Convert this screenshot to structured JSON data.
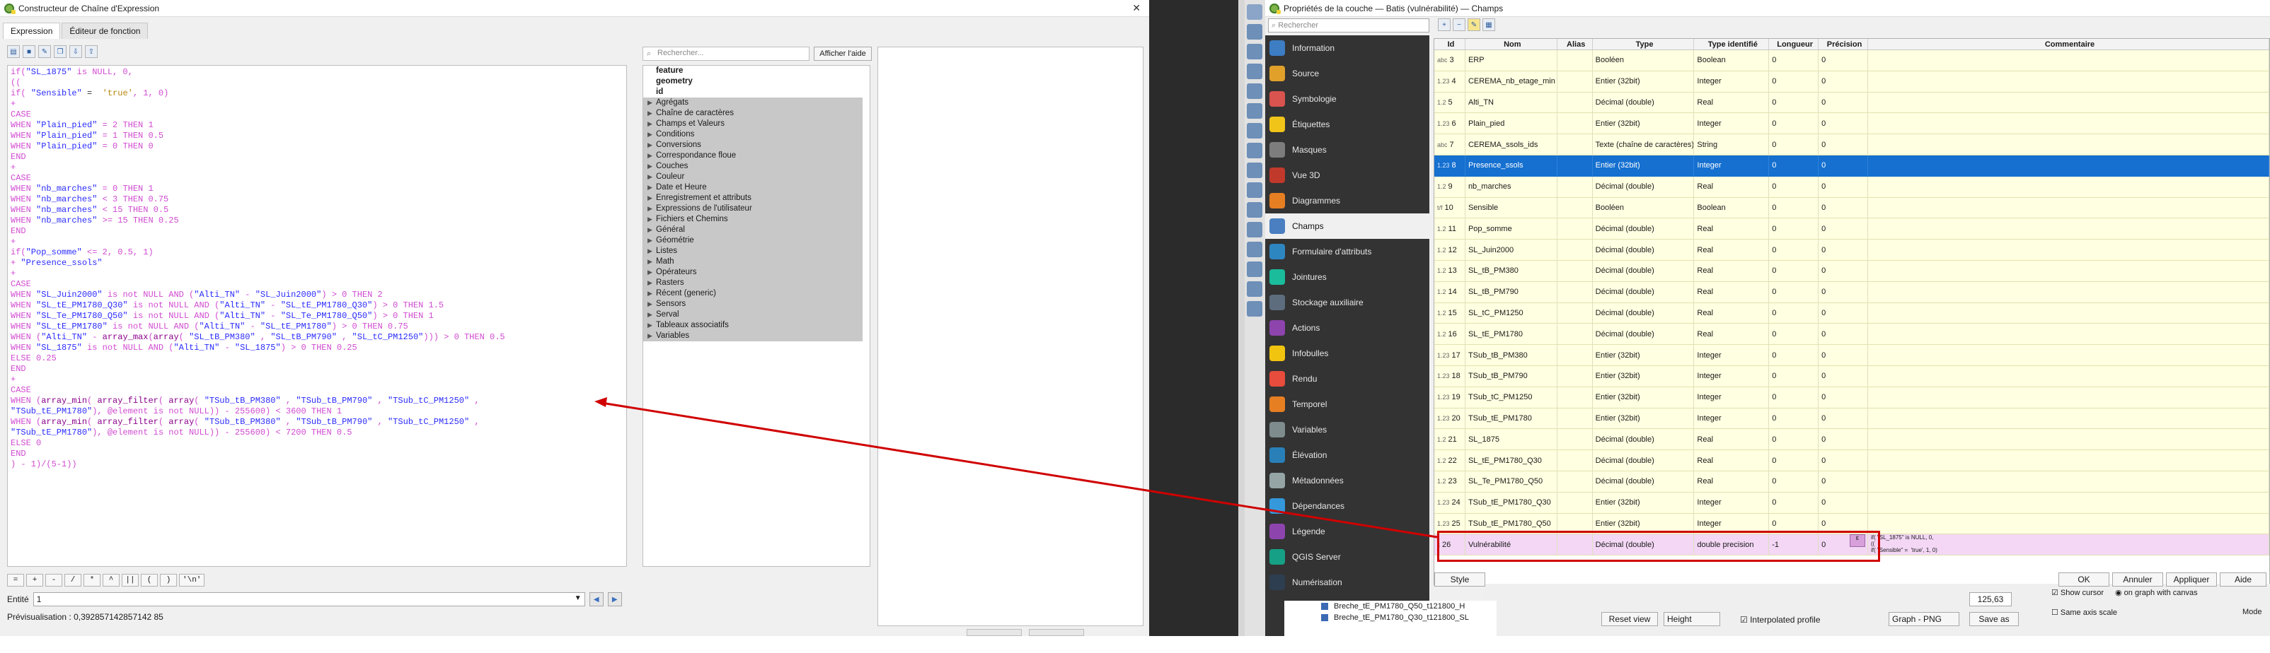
{
  "left_window": {
    "title": "Constructeur de Chaîne d'Expression",
    "tabs": [
      "Expression",
      "Éditeur de fonction"
    ],
    "code_lines": [
      [
        [
          "p",
          "if("
        ],
        [
          "k",
          "\"SL_1875\""
        ],
        [
          "p",
          " is NULL, 0,"
        ]
      ],
      [
        [
          "p",
          "(("
        ]
      ],
      [
        [
          "p",
          "if( "
        ],
        [
          "k",
          "\"Sensible\""
        ],
        [
          "d",
          " =  "
        ],
        [
          "s",
          "'true'"
        ],
        [
          "p",
          ", 1, 0)"
        ]
      ],
      [
        [
          "p",
          "+"
        ]
      ],
      [
        [
          "p",
          "CASE"
        ]
      ],
      [
        [
          "p",
          "WHEN "
        ],
        [
          "k",
          "\"Plain_pied\""
        ],
        [
          "p",
          " = 2 THEN 1"
        ]
      ],
      [
        [
          "p",
          "WHEN "
        ],
        [
          "k",
          "\"Plain_pied\""
        ],
        [
          "p",
          " = 1 THEN 0.5"
        ]
      ],
      [
        [
          "p",
          "WHEN "
        ],
        [
          "k",
          "\"Plain_pied\""
        ],
        [
          "p",
          " = 0 THEN 0"
        ]
      ],
      [
        [
          "p",
          "END"
        ]
      ],
      [
        [
          "p",
          "+"
        ]
      ],
      [
        [
          "p",
          "CASE"
        ]
      ],
      [
        [
          "p",
          "WHEN "
        ],
        [
          "k",
          "\"nb_marches\""
        ],
        [
          "p",
          " = 0 THEN 1"
        ]
      ],
      [
        [
          "p",
          "WHEN "
        ],
        [
          "k",
          "\"nb_marches\""
        ],
        [
          "p",
          " < 3 THEN 0.75"
        ]
      ],
      [
        [
          "p",
          "WHEN "
        ],
        [
          "k",
          "\"nb_marches\""
        ],
        [
          "p",
          " < 15 THEN 0.5"
        ]
      ],
      [
        [
          "p",
          "WHEN "
        ],
        [
          "k",
          "\"nb_marches\""
        ],
        [
          "p",
          " >= 15 THEN 0.25"
        ]
      ],
      [
        [
          "p",
          "END"
        ]
      ],
      [
        [
          "p",
          "+"
        ]
      ],
      [
        [
          "p",
          "if("
        ],
        [
          "k",
          "\"Pop_somme\""
        ],
        [
          "p",
          " <= 2, 0.5, 1)"
        ]
      ],
      [
        [
          "p",
          "+ "
        ],
        [
          "k",
          "\"Presence_ssols\""
        ]
      ],
      [
        [
          "p",
          "+"
        ]
      ],
      [
        [
          "p",
          "CASE"
        ]
      ],
      [
        [
          "p",
          "WHEN "
        ],
        [
          "k",
          "\"SL_Juin2000\""
        ],
        [
          "p",
          " is not NULL AND ("
        ],
        [
          "k",
          "\"Alti_TN\""
        ],
        [
          "p",
          " - "
        ],
        [
          "k",
          "\"SL_Juin2000\""
        ],
        [
          "p",
          ") > 0 THEN 2"
        ]
      ],
      [
        [
          "p",
          "WHEN "
        ],
        [
          "k",
          "\"SL_tE_PM1780_Q30\""
        ],
        [
          "p",
          " is not NULL AND ("
        ],
        [
          "k",
          "\"Alti_TN\""
        ],
        [
          "p",
          " - "
        ],
        [
          "k",
          "\"SL_tE_PM1780_Q30\""
        ],
        [
          "p",
          ") > 0 THEN 1.5"
        ]
      ],
      [
        [
          "p",
          "WHEN "
        ],
        [
          "k",
          "\"SL_Te_PM1780_Q50\""
        ],
        [
          "p",
          " is not NULL AND ("
        ],
        [
          "k",
          "\"Alti_TN\""
        ],
        [
          "p",
          " - "
        ],
        [
          "k",
          "\"SL_Te_PM1780_Q50\""
        ],
        [
          "p",
          ") > 0 THEN 1"
        ]
      ],
      [
        [
          "p",
          "WHEN "
        ],
        [
          "k",
          "\"SL_tE_PM1780\""
        ],
        [
          "p",
          " is not NULL AND ("
        ],
        [
          "k",
          "\"Alti_TN\""
        ],
        [
          "p",
          " - "
        ],
        [
          "k",
          "\"SL_tE_PM1780\""
        ],
        [
          "p",
          ") > 0 THEN 0.75"
        ]
      ],
      [
        [
          "p",
          "WHEN ("
        ],
        [
          "k",
          "\"Alti_TN\""
        ],
        [
          "p",
          " - "
        ],
        [
          "fn",
          "array_max"
        ],
        [
          "p",
          "("
        ],
        [
          "fn",
          "array"
        ],
        [
          "p",
          "( "
        ],
        [
          "k",
          "\"SL_tB_PM380\""
        ],
        [
          "p",
          " , "
        ],
        [
          "k",
          "\"SL_tB_PM790\""
        ],
        [
          "p",
          " , "
        ],
        [
          "k",
          "\"SL_tC_PM1250\""
        ],
        [
          "p",
          "))) > 0 THEN 0.5"
        ]
      ],
      [
        [
          "p",
          "WHEN "
        ],
        [
          "k",
          "\"SL_1875\""
        ],
        [
          "p",
          " is not NULL AND ("
        ],
        [
          "k",
          "\"Alti_TN\""
        ],
        [
          "p",
          " - "
        ],
        [
          "k",
          "\"SL_1875\""
        ],
        [
          "p",
          ") > 0 THEN 0.25"
        ]
      ],
      [
        [
          "p",
          "ELSE 0.25"
        ]
      ],
      [
        [
          "p",
          "END"
        ]
      ],
      [
        [
          "p",
          "+"
        ]
      ],
      [
        [
          "p",
          "CASE"
        ]
      ],
      [
        [
          "p",
          "WHEN ("
        ],
        [
          "fn",
          "array_min"
        ],
        [
          "p",
          "( "
        ],
        [
          "fn",
          "array_filter"
        ],
        [
          "p",
          "( "
        ],
        [
          "fn",
          "array"
        ],
        [
          "p",
          "( "
        ],
        [
          "k",
          "\"TSub_tB_PM380\""
        ],
        [
          "p",
          " , "
        ],
        [
          "k",
          "\"TSub_tB_PM790\""
        ],
        [
          "p",
          " , "
        ],
        [
          "k",
          "\"TSub_tC_PM1250\""
        ],
        [
          "p",
          " ,"
        ]
      ],
      [
        [
          "k",
          "\"TSub_tE_PM1780\""
        ],
        [
          "p",
          "), @element is not NULL)) - 255600) < 3600 THEN 1"
        ]
      ],
      [
        [
          "p",
          "WHEN ("
        ],
        [
          "fn",
          "array_min"
        ],
        [
          "p",
          "( "
        ],
        [
          "fn",
          "array_filter"
        ],
        [
          "p",
          "( "
        ],
        [
          "fn",
          "array"
        ],
        [
          "p",
          "( "
        ],
        [
          "k",
          "\"TSub_tB_PM380\""
        ],
        [
          "p",
          " , "
        ],
        [
          "k",
          "\"TSub_tB_PM790\""
        ],
        [
          "p",
          " , "
        ],
        [
          "k",
          "\"TSub_tC_PM1250\""
        ],
        [
          "p",
          " ,"
        ]
      ],
      [
        [
          "k",
          "\"TSub_tE_PM1780\""
        ],
        [
          "p",
          "), @element is not NULL)) - 255600) < 7200 THEN 0.5"
        ]
      ],
      [
        [
          "p",
          "ELSE 0"
        ]
      ],
      [
        [
          "p",
          "END"
        ]
      ],
      [
        [
          "p",
          ") - 1)/(5-1))"
        ]
      ]
    ],
    "operators": [
      "=",
      "+",
      "-",
      "/",
      "*",
      "^",
      "||",
      "(",
      ")",
      "'\\n'"
    ],
    "entity_label": "Entité",
    "entity_value": "1",
    "preview_label": "Prévisualisation :",
    "preview_value": "0,392857142857142 85",
    "search_placeholder": "Rechercher...",
    "help_button": "Afficher l'aide",
    "tree_top": [
      "feature",
      "geometry",
      "id"
    ],
    "tree_groups": [
      "Agrégats",
      "Chaîne de caractères",
      "Champs et Valeurs",
      "Conditions",
      "Conversions",
      "Correspondance floue",
      "Couches",
      "Couleur",
      "Date et Heure",
      "Enregistrement et attributs",
      "Expressions de l'utilisateur",
      "Fichiers et Chemins",
      "Général",
      "Géométrie",
      "Listes",
      "Math",
      "Opérateurs",
      "Rasters",
      "Récent (generic)",
      "Sensors",
      "Serval",
      "Tableaux associatifs",
      "Variables"
    ]
  },
  "right_window": {
    "title": "Propriétés de la couche — Batis (vulnérabilité) — Champs",
    "search_placeholder": "Rechercher",
    "sidebar": [
      "Information",
      "Source",
      "Symbologie",
      "Étiquettes",
      "Masques",
      "Vue 3D",
      "Diagrammes",
      "Champs",
      "Formulaire d'attributs",
      "Jointures",
      "Stockage auxiliaire",
      "Actions",
      "Infobulles",
      "Rendu",
      "Temporel",
      "Variables",
      "Élévation",
      "Métadonnées",
      "Dépendances",
      "Légende",
      "QGIS Server",
      "Numérisation"
    ],
    "sidebar_colors": [
      "#3c7dc4",
      "#e0a02a",
      "#d9534f",
      "#f0c419",
      "#7d7d7d",
      "#c0392b",
      "#e67e22",
      "#4a7fc1",
      "#2e86c1",
      "#1abc9c",
      "#5d6d7e",
      "#8e44ad",
      "#f1c40f",
      "#e74c3c",
      "#e67e22",
      "#7f8c8d",
      "#2980b9",
      "#95a5a6",
      "#3498db",
      "#8e44ad",
      "#16a085",
      "#2c3e50"
    ],
    "columns": [
      "Id",
      "Nom",
      "Alias",
      "Type",
      "Type identifié",
      "Longueur",
      "Précision",
      "Commentaire"
    ],
    "rows": [
      [
        "abc",
        "3",
        "ERP",
        "",
        "Booléen",
        "Boolean",
        "0",
        "0",
        ""
      ],
      [
        "1.23",
        "4",
        "CEREMA_nb_etage_min",
        "",
        "Entier (32bit)",
        "Integer",
        "0",
        "0",
        ""
      ],
      [
        "1.2",
        "5",
        "Alti_TN",
        "",
        "Décimal (double)",
        "Real",
        "0",
        "0",
        ""
      ],
      [
        "1.23",
        "6",
        "Plain_pied",
        "",
        "Entier (32bit)",
        "Integer",
        "0",
        "0",
        ""
      ],
      [
        "abc",
        "7",
        "CEREMA_ssols_ids",
        "",
        "Texte (chaîne de caractères)",
        "String",
        "0",
        "0",
        ""
      ],
      [
        "1.23",
        "8",
        "Presence_ssols",
        "",
        "Entier (32bit)",
        "Integer",
        "0",
        "0",
        ""
      ],
      [
        "1.2",
        "9",
        "nb_marches",
        "",
        "Décimal (double)",
        "Real",
        "0",
        "0",
        ""
      ],
      [
        "t/f",
        "10",
        "Sensible",
        "",
        "Booléen",
        "Boolean",
        "0",
        "0",
        ""
      ],
      [
        "1.2",
        "11",
        "Pop_somme",
        "",
        "Décimal (double)",
        "Real",
        "0",
        "0",
        ""
      ],
      [
        "1.2",
        "12",
        "SL_Juin2000",
        "",
        "Décimal (double)",
        "Real",
        "0",
        "0",
        ""
      ],
      [
        "1.2",
        "13",
        "SL_tB_PM380",
        "",
        "Décimal (double)",
        "Real",
        "0",
        "0",
        ""
      ],
      [
        "1.2",
        "14",
        "SL_tB_PM790",
        "",
        "Décimal (double)",
        "Real",
        "0",
        "0",
        ""
      ],
      [
        "1.2",
        "15",
        "SL_tC_PM1250",
        "",
        "Décimal (double)",
        "Real",
        "0",
        "0",
        ""
      ],
      [
        "1.2",
        "16",
        "SL_tE_PM1780",
        "",
        "Décimal (double)",
        "Real",
        "0",
        "0",
        ""
      ],
      [
        "1.23",
        "17",
        "TSub_tB_PM380",
        "",
        "Entier (32bit)",
        "Integer",
        "0",
        "0",
        ""
      ],
      [
        "1.23",
        "18",
        "TSub_tB_PM790",
        "",
        "Entier (32bit)",
        "Integer",
        "0",
        "0",
        ""
      ],
      [
        "1.23",
        "19",
        "TSub_tC_PM1250",
        "",
        "Entier (32bit)",
        "Integer",
        "0",
        "0",
        ""
      ],
      [
        "1.23",
        "20",
        "TSub_tE_PM1780",
        "",
        "Entier (32bit)",
        "Integer",
        "0",
        "0",
        ""
      ],
      [
        "1.2",
        "21",
        "SL_1875",
        "",
        "Décimal (double)",
        "Real",
        "0",
        "0",
        ""
      ],
      [
        "1.2",
        "22",
        "SL_tE_PM1780_Q30",
        "",
        "Décimal (double)",
        "Real",
        "0",
        "0",
        ""
      ],
      [
        "1.2",
        "23",
        "SL_Te_PM1780_Q50",
        "",
        "Décimal (double)",
        "Real",
        "0",
        "0",
        ""
      ],
      [
        "1.23",
        "24",
        "TSub_tE_PM1780_Q30",
        "",
        "Entier (32bit)",
        "Integer",
        "0",
        "0",
        ""
      ],
      [
        "1.23",
        "25",
        "TSub_tE_PM1780_Q50",
        "",
        "Entier (32bit)",
        "Integer",
        "0",
        "0",
        ""
      ],
      [
        "ε",
        "26",
        "Vulnérabilité",
        "",
        "Décimal (double)",
        "double precision",
        "-1",
        "0",
        ""
      ]
    ],
    "selected_row": 5,
    "virtual_row": 23,
    "virtual_comment": "if( \"SL_1875\" is NULL, 0,\n((\nif( \"Sensible\" =  'true', 1, 0)",
    "style_button": "Style",
    "ok": "OK",
    "cancel": "Annuler",
    "apply": "Appliquer",
    "help": "Aide",
    "reset_view": "Reset view",
    "height_combo": "Height",
    "interpolated_profile": "Interpolated profile",
    "graph_combo": "Graph - PNG",
    "save_as": "Save as",
    "value_field": "125,63",
    "show_cursor": "Show cursor",
    "on_graph": "on graph with canvas",
    "same_axis": "Same axis scale",
    "mode": "Mode",
    "layers": [
      "Breche_tE_PM1780_Q50_t121800_H",
      "Breche_tE_PM1780_Q30_t121800_SL"
    ]
  },
  "colors": {
    "selection": "#1570d0",
    "row_bg": "#ffffe1",
    "virtual_bg": "#f3d7f5",
    "annotation": "#d00000"
  }
}
